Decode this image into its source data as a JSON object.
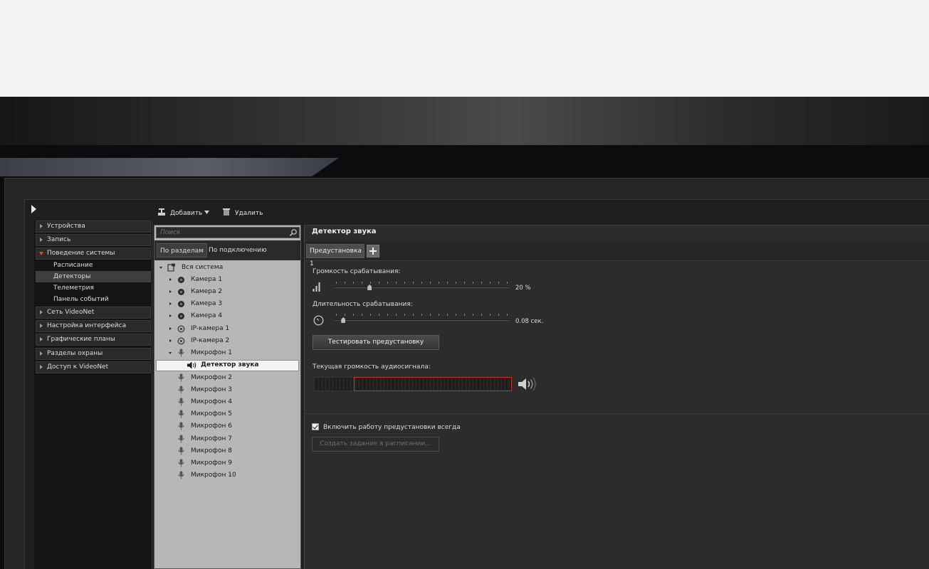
{
  "toolbar": {
    "add_label": "Добавить",
    "delete_label": "Удалить"
  },
  "nav": {
    "items": [
      {
        "label": "Устройства"
      },
      {
        "label": "Запись"
      },
      {
        "label": "Поведение системы"
      },
      {
        "label": "Сеть VideoNet"
      },
      {
        "label": "Настройка интерфейса"
      },
      {
        "label": "Графические планы"
      },
      {
        "label": "Разделы охраны"
      },
      {
        "label": "Доступ к VideoNet"
      }
    ],
    "subitems": [
      {
        "label": "Расписание"
      },
      {
        "label": "Детекторы"
      },
      {
        "label": "Телеметрия"
      },
      {
        "label": "Панель событий"
      }
    ],
    "active_subitem": "Детекторы"
  },
  "tree": {
    "search_placeholder": "Поиск",
    "tabs": [
      {
        "label": "По разделам"
      },
      {
        "label": "По подключению"
      }
    ],
    "nodes": [
      {
        "label": "Вся система"
      },
      {
        "label": "Камера 1"
      },
      {
        "label": "Камера 2"
      },
      {
        "label": "Камера 3"
      },
      {
        "label": "Камера 4"
      },
      {
        "label": "IP-камера 1"
      },
      {
        "label": "IP-камера 2"
      },
      {
        "label": "Микрофон 1"
      },
      {
        "label": "Детектор звука"
      },
      {
        "label": "Микрофон 2"
      },
      {
        "label": "Микрофон 3"
      },
      {
        "label": "Микрофон 4"
      },
      {
        "label": "Микрофон 5"
      },
      {
        "label": "Микрофон 6"
      },
      {
        "label": "Микрофон 7"
      },
      {
        "label": "Микрофон 8"
      },
      {
        "label": "Микрофон 9"
      },
      {
        "label": "Микрофон 10"
      }
    ],
    "selected": "Детектор звука"
  },
  "detector": {
    "title": "Детектор звука",
    "preset_tab": "Предустановка 1",
    "volume_label": "Громкость срабатывания:",
    "volume_value": "20 %",
    "volume_fraction": 0.2,
    "duration_label": "Длительность срабатывания:",
    "duration_value": "0.08 сек.",
    "duration_fraction": 0.05,
    "test_button": "Тестировать предустановку",
    "current_label": "Текущая громкость аудиосигнала:",
    "always_label": "Включить работу предустановки всегда",
    "always_checked": true,
    "schedule_button": "Создать задание в расписании..."
  },
  "colors": {
    "accent": "#e0541a",
    "threshold": "#c0392b"
  }
}
